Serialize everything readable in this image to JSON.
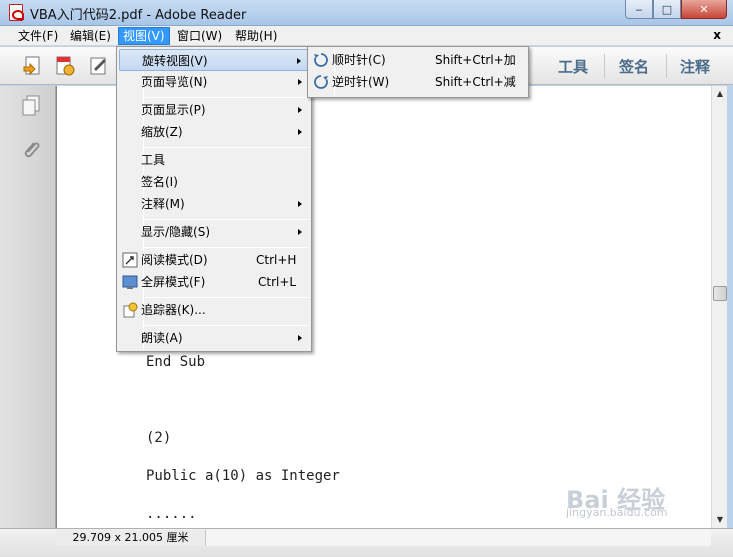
{
  "window": {
    "title": "VBA入门代码2.pdf - Adobe Reader",
    "controls": {
      "minimize": "‒",
      "maximize": "□",
      "close": "✕"
    }
  },
  "menubar": {
    "items": [
      "文件(F)",
      "编辑(E)",
      "视图(V)",
      "窗口(W)",
      "帮助(H)"
    ],
    "active": "视图(V)",
    "doc_close": "x"
  },
  "toolbar": {
    "icons": [
      "create-pdf-icon",
      "tools-gear-icon",
      "sign-icon"
    ],
    "right_tabs": [
      "工具",
      "签名",
      "注释"
    ]
  },
  "navpane": {
    "icons": [
      "pages-icon",
      "attachment-paperclip-icon"
    ]
  },
  "view_menu": {
    "items": [
      {
        "label": "旋转视图(V)",
        "shortcut": "",
        "submenu": true,
        "highlighted": true
      },
      {
        "label": "页面导览(N)",
        "shortcut": "",
        "submenu": true
      },
      {
        "label": "页面显示(P)",
        "shortcut": "",
        "submenu": true
      },
      {
        "label": "缩放(Z)",
        "shortcut": "",
        "submenu": true
      },
      {
        "label": "工具",
        "shortcut": "",
        "submenu": false
      },
      {
        "label": "签名(I)",
        "shortcut": "",
        "submenu": false
      },
      {
        "label": "注释(M)",
        "shortcut": "",
        "submenu": true
      },
      {
        "label": "显示/隐藏(S)",
        "shortcut": "",
        "submenu": true
      },
      {
        "label": "阅读模式(D)",
        "shortcut": "Ctrl+H",
        "submenu": false,
        "icon": "read-mode-icon"
      },
      {
        "label": "全屏模式(F)",
        "shortcut": "Ctrl+L",
        "submenu": false,
        "icon": "fullscreen-icon"
      },
      {
        "label": "追踪器(K)...",
        "shortcut": "",
        "submenu": false,
        "icon": "tracker-icon"
      },
      {
        "label": "朗读(A)",
        "shortcut": "",
        "submenu": true
      }
    ]
  },
  "rotate_submenu": {
    "items": [
      {
        "label": "顺时针(C)",
        "shortcut": "Shift+Ctrl+加",
        "icon": "rotate-clockwise-icon"
      },
      {
        "label": "逆时针(W)",
        "shortcut": "Shift+Ctrl+减",
        "icon": "rotate-counterclockwise-icon"
      }
    ]
  },
  "document": {
    "lines": [
      "End Sub",
      "(2)",
      "Public a(10) as Integer",
      "......"
    ]
  },
  "statusbar": {
    "page_size": "29.709 x 21.005 厘米"
  },
  "watermark": {
    "brand": "Bai 经验",
    "url": "jingyan.baidu.com"
  }
}
